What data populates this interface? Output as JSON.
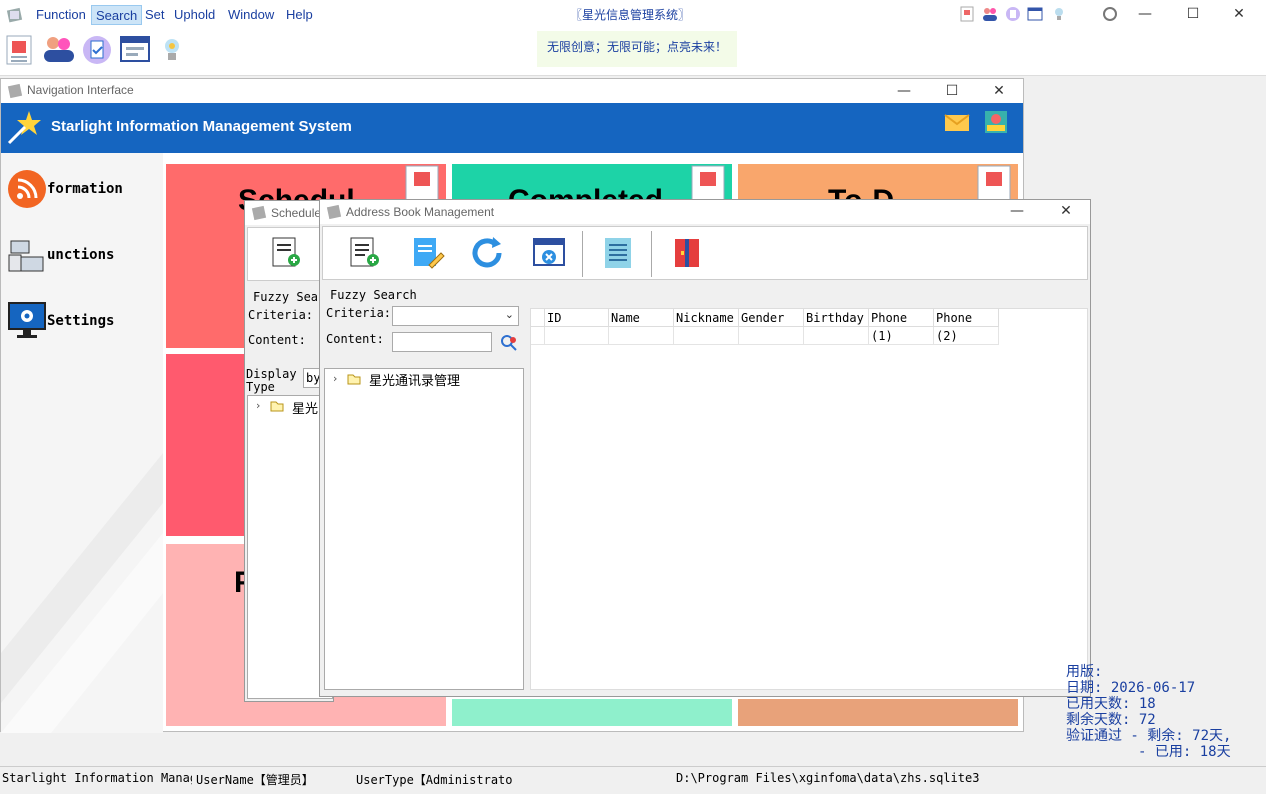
{
  "menu": {
    "items": [
      "Function",
      "Search",
      "Set",
      "Uphold",
      "Window",
      "Help"
    ],
    "active": "Search"
  },
  "app_title": "〖星光信息管理系统〗",
  "slogan": "无限创意；无限可能；点亮未来！",
  "nav_window": {
    "title": "Navigation Interface",
    "banner": "Starlight Information Management System",
    "side_items": [
      "formation",
      "unctions",
      "Settings"
    ]
  },
  "tiles": {
    "schedule_fragment": "Schedul",
    "completed_fragment": "Completed",
    "todo_fragment": "To-D",
    "bottom_left_fragment": "F"
  },
  "schedule_window": {
    "title": "Schedule",
    "fuzzy_search": "Fuzzy Sea",
    "criteria_label": "Criteria:",
    "content_label": "Content:",
    "display_type_label": "Display Type",
    "display_type_value": "by",
    "tree_root": "星光"
  },
  "address_book": {
    "title": "Address Book Management",
    "fuzzy_search_label": "Fuzzy Search",
    "criteria_label": "Criteria:",
    "content_label": "Content:",
    "criteria_value": "",
    "content_value": "",
    "tree_root": "星光通讯录管理",
    "columns": [
      "ID",
      "Name",
      "Nickname",
      "Gender",
      "Birthday",
      "Phone (1)",
      "Phone (2)"
    ]
  },
  "trial_info": {
    "line1": "用版:",
    "line2": "日期: 2026-06-17",
    "line3": "已用天数: 18",
    "line4": "剩余天数: 72",
    "line5": "验证通过 - 剩余: 72天,",
    "line6": "- 已用: 18天"
  },
  "status": {
    "app": "Starlight Information Manage",
    "user": "UserName【管理员】",
    "user_type": "UserType【Administrato",
    "db_path": "D:\\Program Files\\xginfoma\\data\\zhs.sqlite3"
  },
  "colors": {
    "banner": "#1565c0",
    "tile_schedule": "#ff6b6b",
    "tile_completed": "#1dd3a7",
    "tile_todo": "#f9a66c",
    "menu_text": "#1a3fa0"
  }
}
